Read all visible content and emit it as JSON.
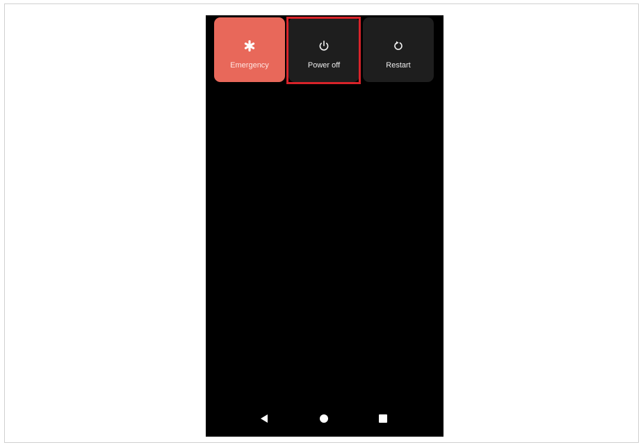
{
  "power_menu": {
    "items": [
      {
        "label": "Emergency",
        "icon": "asterisk-icon"
      },
      {
        "label": "Power off",
        "icon": "power-icon"
      },
      {
        "label": "Restart",
        "icon": "restart-icon"
      }
    ],
    "highlighted_item": "Power off"
  },
  "navigation_bar": {
    "buttons": [
      {
        "icon": "back-icon"
      },
      {
        "icon": "home-icon"
      },
      {
        "icon": "recents-icon"
      }
    ]
  },
  "colors": {
    "emergency_tile": "#e8685a",
    "dark_tile": "#1e1e1e",
    "screen_background": "#000000",
    "highlight_border": "#d8232a"
  }
}
